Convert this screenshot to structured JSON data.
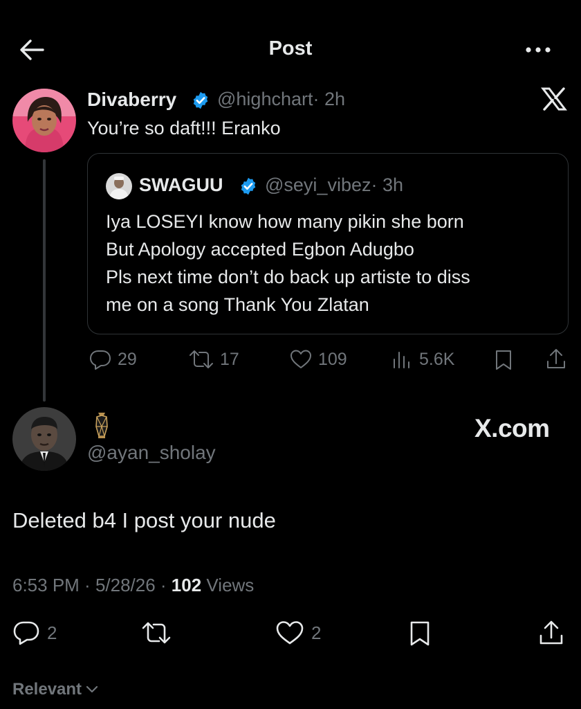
{
  "header": {
    "title": "Post",
    "back_icon": "arrow-left-icon",
    "more_icon": "more-horizontal-icon"
  },
  "post": {
    "author_name": "Divaberry",
    "author_handle": "@highchart",
    "time": "· 2h",
    "text": "You’re so daft!!! Eranko",
    "brand_icon": "x-logo-icon",
    "quote": {
      "author_name": "SWAGUU",
      "author_handle": "@seyi_vibez",
      "time": "· 3h",
      "lines": [
        "Iya LOSEYI know how many pikin she born",
        "But Apology accepted Egbon Adugbo",
        "Pls next time don’t do back up artiste to diss",
        "me on a song Thank You Zlatan"
      ]
    },
    "stats": {
      "replies": "29",
      "reposts": "17",
      "likes": "109",
      "views": "5.6K"
    }
  },
  "reply": {
    "display_name_icon": "urn-icon",
    "author_handle": "@ayan_sholay",
    "watermark": "X.com",
    "text": "Deleted b4 I post your nude",
    "time": "6:53 PM",
    "date": "5/28/26",
    "views_count": "102",
    "views_label": "Views",
    "actions": {
      "replies": "2",
      "likes": "2"
    }
  },
  "sort": {
    "label": "Relevant",
    "icon": "chevron-down-icon"
  },
  "colors": {
    "background": "#000000",
    "text": "#e7e9ea",
    "muted": "#71767b",
    "verified": "#1d9bf0",
    "border": "#2f3336"
  }
}
